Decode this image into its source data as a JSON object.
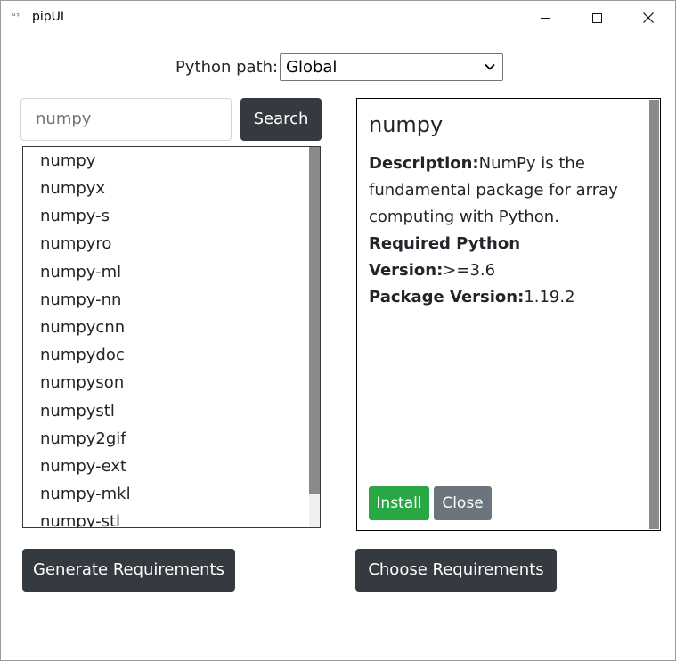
{
  "window": {
    "icon_text": "ᵘᵎ",
    "title": "pipUI"
  },
  "python_path": {
    "label": "Python path:",
    "selected": "Global"
  },
  "search": {
    "value": "numpy",
    "button_label": "Search"
  },
  "results": [
    "numpy",
    "numpyx",
    "numpy-s",
    "numpyro",
    "numpy-ml",
    "numpy-nn",
    "numpycnn",
    "numpydoc",
    "numpyson",
    "numpystl",
    "numpy2gif",
    "numpy-ext",
    "numpy-mkl",
    "numpy-stl"
  ],
  "detail": {
    "title": "numpy",
    "description_label": "Description:",
    "description": "NumPy is the fundamental package for array computing with Python.",
    "python_version_label": "Required Python Version:",
    "python_version": ">=3.6",
    "package_version_label": "Package Version:",
    "package_version": "1.19.2",
    "install_label": "Install",
    "close_label": "Close"
  },
  "footer": {
    "generate_label": "Generate Requirements",
    "choose_label": "Choose Requirements"
  },
  "colors": {
    "dark_button": "#343a40",
    "install_green": "#28a745",
    "close_gray": "#6c757d"
  }
}
